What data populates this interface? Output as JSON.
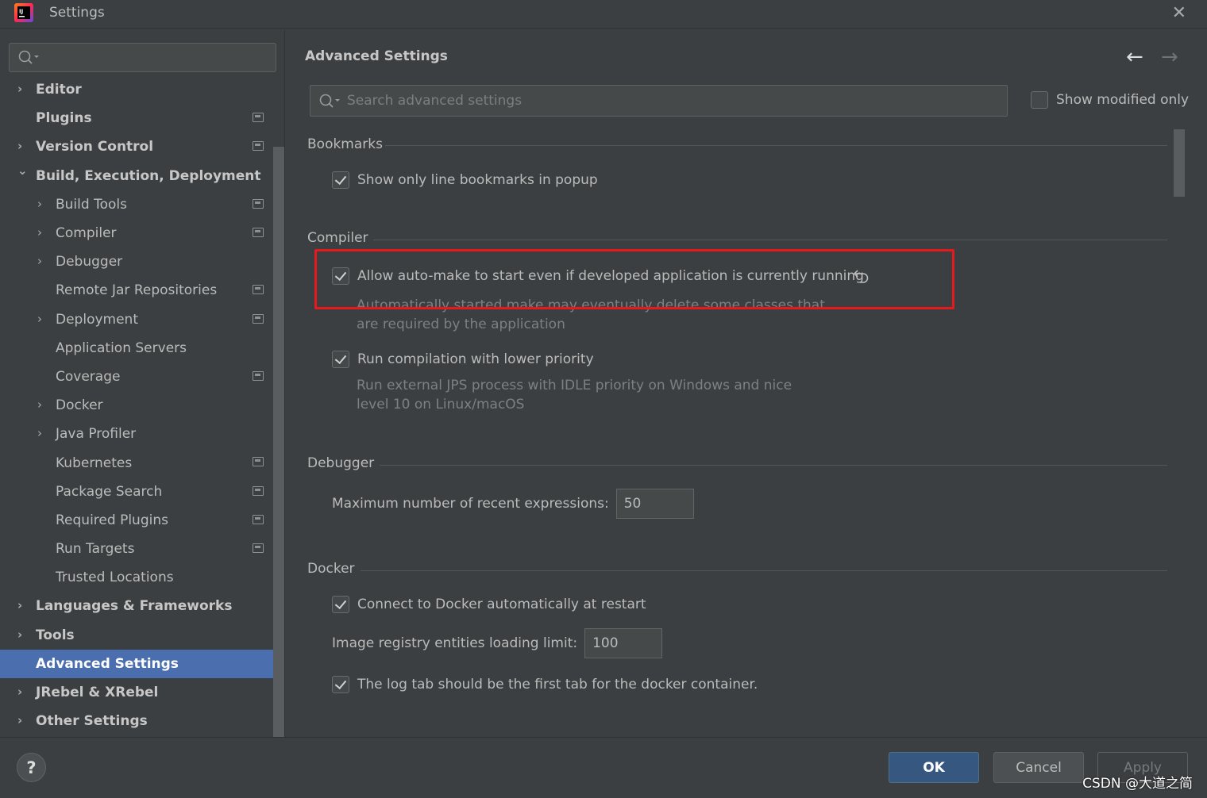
{
  "window": {
    "title": "Settings"
  },
  "sidebar": {
    "search_placeholder": "",
    "items": [
      {
        "label": "Editor",
        "level": 0,
        "arrow": "›",
        "bold": true,
        "project": false
      },
      {
        "label": "Plugins",
        "level": 0,
        "arrow": "",
        "bold": true,
        "project": true
      },
      {
        "label": "Version Control",
        "level": 0,
        "arrow": "›",
        "bold": true,
        "project": true
      },
      {
        "label": "Build, Execution, Deployment",
        "level": 0,
        "arrow": "⌄",
        "bold": true,
        "project": false
      },
      {
        "label": "Build Tools",
        "level": 1,
        "arrow": "›",
        "bold": false,
        "project": true
      },
      {
        "label": "Compiler",
        "level": 1,
        "arrow": "›",
        "bold": false,
        "project": true
      },
      {
        "label": "Debugger",
        "level": 1,
        "arrow": "›",
        "bold": false,
        "project": false
      },
      {
        "label": "Remote Jar Repositories",
        "level": 1,
        "arrow": "",
        "bold": false,
        "project": true
      },
      {
        "label": "Deployment",
        "level": 1,
        "arrow": "›",
        "bold": false,
        "project": true
      },
      {
        "label": "Application Servers",
        "level": 1,
        "arrow": "",
        "bold": false,
        "project": false
      },
      {
        "label": "Coverage",
        "level": 1,
        "arrow": "",
        "bold": false,
        "project": true
      },
      {
        "label": "Docker",
        "level": 1,
        "arrow": "›",
        "bold": false,
        "project": false
      },
      {
        "label": "Java Profiler",
        "level": 1,
        "arrow": "›",
        "bold": false,
        "project": false
      },
      {
        "label": "Kubernetes",
        "level": 1,
        "arrow": "",
        "bold": false,
        "project": true
      },
      {
        "label": "Package Search",
        "level": 1,
        "arrow": "",
        "bold": false,
        "project": true
      },
      {
        "label": "Required Plugins",
        "level": 1,
        "arrow": "",
        "bold": false,
        "project": true
      },
      {
        "label": "Run Targets",
        "level": 1,
        "arrow": "",
        "bold": false,
        "project": true
      },
      {
        "label": "Trusted Locations",
        "level": 1,
        "arrow": "",
        "bold": false,
        "project": false
      },
      {
        "label": "Languages & Frameworks",
        "level": 0,
        "arrow": "›",
        "bold": true,
        "project": false
      },
      {
        "label": "Tools",
        "level": 0,
        "arrow": "›",
        "bold": true,
        "project": false
      },
      {
        "label": "Advanced Settings",
        "level": 0,
        "arrow": "",
        "bold": true,
        "project": false,
        "selected": true
      },
      {
        "label": "JRebel & XRebel",
        "level": 0,
        "arrow": "›",
        "bold": true,
        "project": false
      },
      {
        "label": "Other Settings",
        "level": 0,
        "arrow": "›",
        "bold": true,
        "project": false
      }
    ]
  },
  "main": {
    "title": "Advanced Settings",
    "back_icon": "arrow-left-icon",
    "forward_icon": "arrow-right-icon",
    "search_placeholder": "Search advanced settings",
    "show_modified_label": "Show modified only",
    "show_modified_checked": false,
    "sections": {
      "bookmarks": {
        "title": "Bookmarks",
        "option1": {
          "label": "Show only line bookmarks in popup",
          "checked": true
        }
      },
      "compiler": {
        "title": "Compiler",
        "option1": {
          "label": "Allow auto-make to start even if developed application is currently running",
          "checked": true,
          "desc_line1": "Automatically started make may eventually delete some classes that",
          "desc_line2": "are required by the application"
        },
        "option2": {
          "label": "Run compilation with lower priority",
          "checked": true,
          "desc_line1": "Run external JPS process with IDLE priority on Windows and nice",
          "desc_line2": "level 10 on Linux/macOS"
        }
      },
      "debugger": {
        "title": "Debugger",
        "field_label": "Maximum number of recent expressions:",
        "field_value": "50"
      },
      "docker": {
        "title": "Docker",
        "option1": {
          "label": "Connect to Docker automatically at restart",
          "checked": true
        },
        "field_label": "Image registry entities loading limit:",
        "field_value": "100",
        "option2": {
          "label": "The log tab should be the first tab for the docker container.",
          "checked": true
        }
      }
    }
  },
  "footer": {
    "help_label": "?",
    "ok_label": "OK",
    "cancel_label": "Cancel",
    "apply_label": "Apply"
  },
  "watermark": "CSDN @大道之简",
  "colors": {
    "background": "#3c3f41",
    "selection": "#4b6eaf",
    "ok_button": "#365880",
    "highlight_annotation": "#e8191c"
  }
}
